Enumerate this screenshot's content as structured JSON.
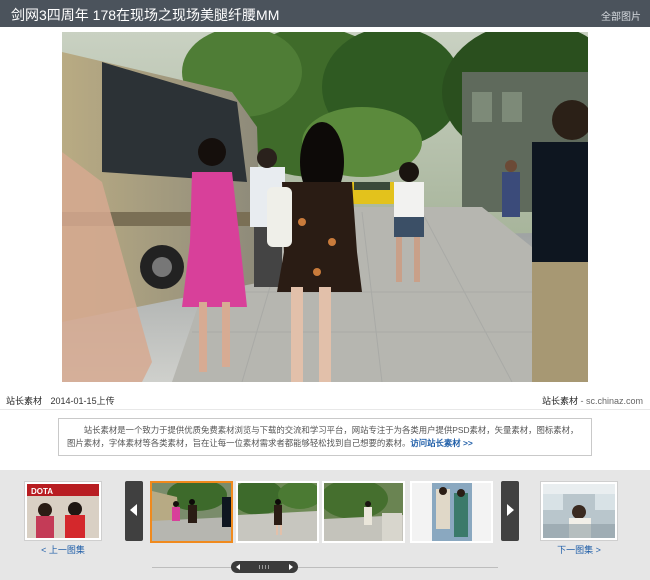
{
  "header": {
    "title": "剑网3四周年 178在现场之现场美腿纤腰MM",
    "all_link": "全部图片"
  },
  "photo": {
    "description": "main-street-photo"
  },
  "info": {
    "author": "站长素材",
    "date": "2014-01-15上传",
    "site_name": "站长素材",
    "site_domain": " - sc.chinaz.com"
  },
  "desc": {
    "text": "站长素材是一个致力于提供优质免费素材浏览与下载的交流和学习平台，网站专注于为各类用户提供PSD素材，矢量素材，图标素材，图片素材，字体素材等各类素材，旨在让每一位素材需求者都能够轻松找到自己想要的素材。",
    "link": "访问站长素材 >>"
  },
  "gallery": {
    "prev_album_label": "< 上一图集",
    "next_album_label": "下一图集 >",
    "selected_index": 0,
    "thumb_count": 4,
    "prev_album_banner": "DOTA"
  },
  "colors": {
    "header_bg": "#4b535c",
    "active_border": "#f08a1d",
    "link": "#1f5ea8"
  }
}
